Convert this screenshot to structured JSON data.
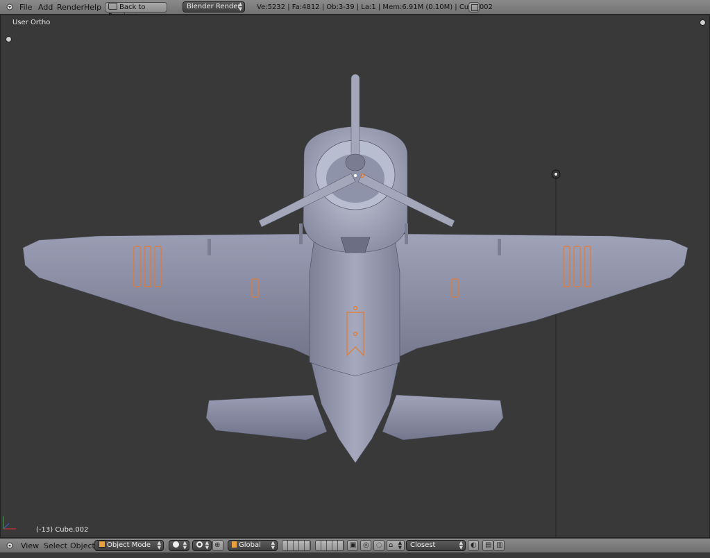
{
  "top_bar": {
    "menu": [
      "File",
      "Add",
      "Render",
      "Help"
    ],
    "back_button": "Back to Previous",
    "render_engine": "Blender Render",
    "stats": "Ve:5232 | Fa:4812 | Ob:3-39 | La:1 | Mem:6.91M (0.10M) | Cube.002"
  },
  "viewport": {
    "view_name": "User Ortho",
    "object_info": "(-13) Cube.002"
  },
  "bottom_bar": {
    "menu": [
      "View",
      "Select",
      "Object"
    ],
    "mode": "Object Mode",
    "orientation": "Global",
    "snap_target": "Closest"
  },
  "colors": {
    "viewport_bg": "#393939",
    "header_bg": "#7d7d7d",
    "model_gray": "#8a8ea5",
    "selection_orange": "#e87a2c"
  },
  "icons": [
    "editor-type-icon",
    "maximize-icon",
    "plus-icon",
    "axis-icon",
    "lamp-icon",
    "cube-icon",
    "sphere-shading-icon",
    "pivot-icon",
    "manipulator-icon",
    "layers-icon",
    "lock-icon",
    "snap-icon",
    "render-icon"
  ]
}
